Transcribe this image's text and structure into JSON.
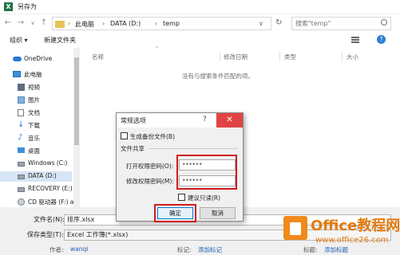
{
  "window": {
    "title": "另存为"
  },
  "address": {
    "crumbs": [
      "此电脑",
      "DATA (D:)",
      "temp"
    ],
    "search_placeholder": "搜索\"temp\""
  },
  "toolbar": {
    "organize": "组织 ▾",
    "new_folder": "新建文件夹"
  },
  "sidebar": {
    "items": [
      {
        "label": "OneDrive",
        "icon": "cloud-icon"
      },
      {
        "label": "此电脑",
        "icon": "computer-icon"
      },
      {
        "label": "视频",
        "icon": "video-icon"
      },
      {
        "label": "图片",
        "icon": "picture-icon"
      },
      {
        "label": "文档",
        "icon": "document-icon"
      },
      {
        "label": "下载",
        "icon": "download-icon"
      },
      {
        "label": "音乐",
        "icon": "music-icon"
      },
      {
        "label": "桌面",
        "icon": "desktop-icon"
      },
      {
        "label": "Windows (C:)",
        "icon": "drive-icon"
      },
      {
        "label": "DATA (D:)",
        "icon": "drive-icon"
      },
      {
        "label": "RECOVERY (E:)",
        "icon": "drive-icon"
      },
      {
        "label": "CD 驱动器 (F:) a",
        "icon": "cd-drive-icon"
      }
    ]
  },
  "columns": [
    "名称",
    "修改日期",
    "类型",
    "大小"
  ],
  "empty_message": "没有与搜索条件匹配的项。",
  "bottom": {
    "filename_label": "文件名(N):",
    "filename_value": "排序.xlsx",
    "filetype_label": "保存类型(T):",
    "filetype_value": "Excel 工作簿(*.xlsx)",
    "author_label": "作者:",
    "author_value": "wanqi",
    "tags_label": "标记:",
    "tags_value": "添加标记",
    "title_label": "标题:",
    "title_value": "添加标题"
  },
  "dialog": {
    "title": "常规选项",
    "help_glyph": "?",
    "close_glyph": "✕",
    "backup_label": "生成备份文件(B)",
    "section_label": "文件共享",
    "open_pw_label": "打开权限密码(O):",
    "open_pw_value": "******",
    "modify_pw_label": "修改权限密码(M):",
    "modify_pw_value": "******",
    "readonly_label": "建议只读(R)",
    "ok_label": "确定",
    "cancel_label": "取消"
  },
  "watermark": {
    "brand": "Office教程网",
    "url": "www.office26.com"
  },
  "colors": {
    "highlight": "#d01c1c",
    "accent": "#0078d7",
    "watermark": "#e37a10"
  }
}
